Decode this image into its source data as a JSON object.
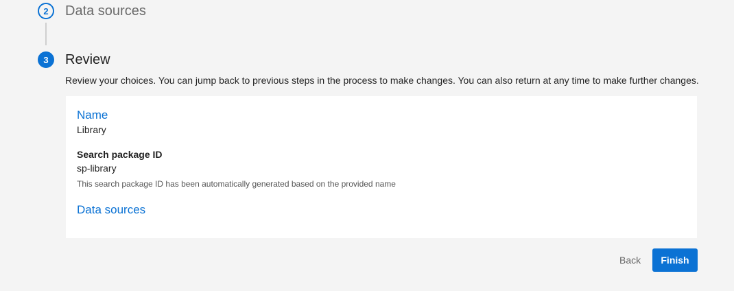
{
  "steps": {
    "step2": {
      "number": "2",
      "title": "Data sources"
    },
    "step3": {
      "number": "3",
      "title": "Review",
      "description": "Review your choices. You can jump back to previous steps in the process to make changes. You can also return at any time to make further changes."
    }
  },
  "review": {
    "name_section": "Name",
    "name_value": "Library",
    "package_id_label": "Search package ID",
    "package_id_value": "sp-library",
    "package_id_help": "This search package ID has been automatically generated based on the provided name",
    "data_sources_section": "Data sources"
  },
  "actions": {
    "back_label": "Back",
    "finish_label": "Finish"
  },
  "colors": {
    "accent": "#0b72d4",
    "background": "#f4f4f4",
    "card": "#ffffff"
  }
}
